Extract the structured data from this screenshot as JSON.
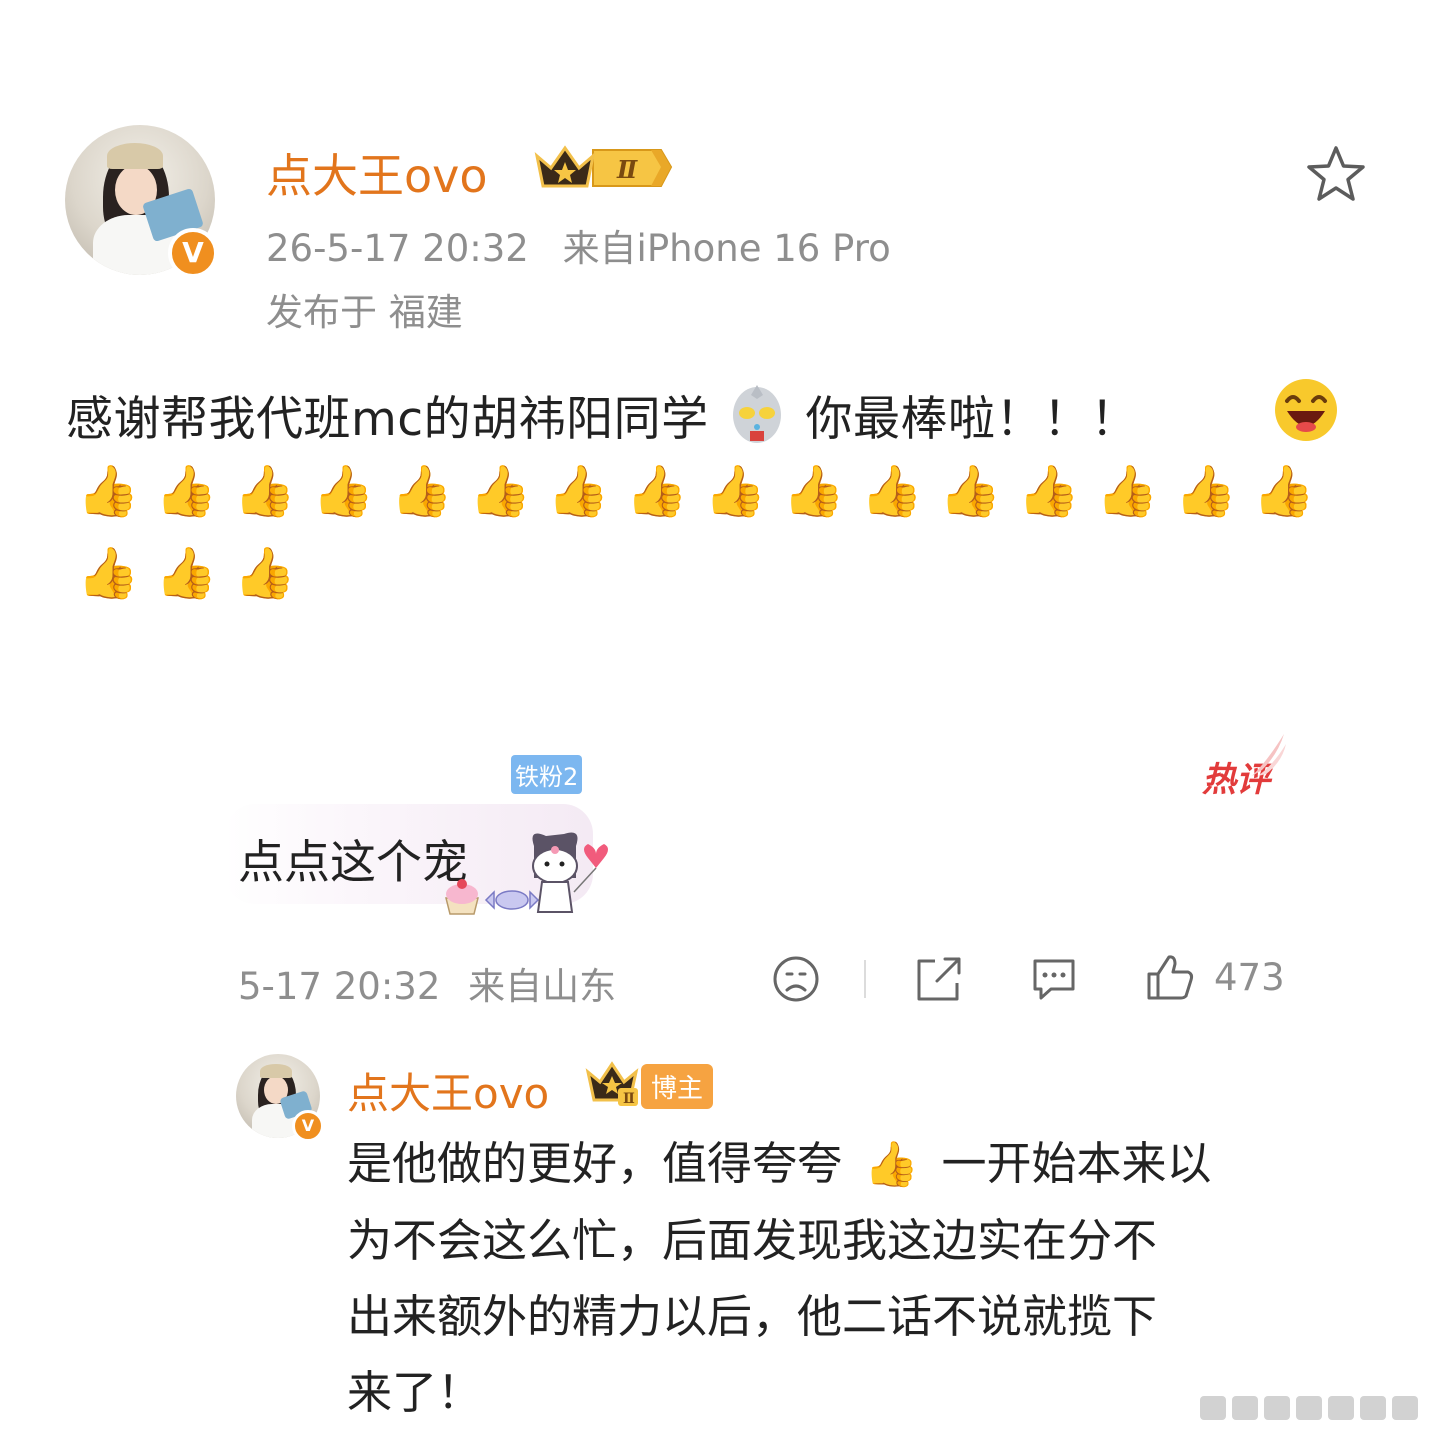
{
  "post": {
    "username": "点大王ovo",
    "level_badge": "Ⅱ",
    "timestamp": "26-5-17 20:32",
    "source": "来自iPhone 16 Pro",
    "location": "发布于 福建",
    "text_part1": "感谢帮我代班mc的胡祎阳同学",
    "text_part2": "你最棒啦！！！",
    "thumbs_emoji": "👍",
    "laugh_emoji": "😄",
    "thumbs_count_row1": 16,
    "thumbs_count_row2": 3
  },
  "hot_comment": {
    "fan_tag": "铁粉2",
    "hot_label": "热评",
    "text": "点点这个宠",
    "time": "5-17 20:32",
    "source": "来自山东",
    "like_count": "473"
  },
  "reply": {
    "username": "点大王ovo",
    "blogger_tag": "博主",
    "lines": [
      "是他做的更好，值得夸夸",
      "一开始本来以",
      "为不会这么忙，后面发现我这边实在分不",
      "出来额外的精力以后，他二话不说就揽下",
      "来了！"
    ]
  },
  "icons": {
    "star": "star-icon",
    "sad": "sad-face-icon",
    "share": "share-icon",
    "comment": "comment-icon",
    "like": "thumbs-up-icon"
  },
  "colors": {
    "username": "#e2751c",
    "meta": "#8e8e8e",
    "fan_tag": "#7cb7f0",
    "hot": "#e23b3b",
    "blogger_tag": "#f6a341"
  }
}
